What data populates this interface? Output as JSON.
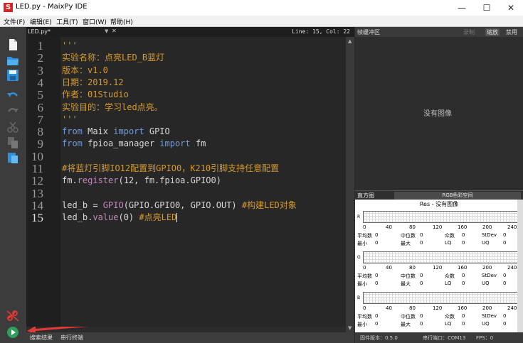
{
  "window": {
    "title": "LED.py - MaixPy IDE",
    "minimize": "—",
    "maximize": "☐",
    "close": "✕"
  },
  "menu": [
    "文件(F)",
    "编辑(E)",
    "工具(T)",
    "窗口(W)",
    "帮助(H)"
  ],
  "toolbar": {
    "tools": [
      "new-file-icon",
      "open-folder-icon",
      "save-icon",
      "undo-icon",
      "redo-icon",
      "cut-icon",
      "copy-icon",
      "paste-icon",
      "disconnect-icon",
      "run-icon"
    ]
  },
  "editor": {
    "file_tab": "LED.py*",
    "cursor": "Line: 15, Col: 22",
    "line_numbers": [
      "1",
      "2",
      "3",
      "4",
      "5",
      "6",
      "7",
      "8",
      "9",
      "10",
      "11",
      "12",
      "13",
      "14",
      "15"
    ],
    "lines": [
      [
        {
          "t": "'''",
          "c": "c-doc"
        }
      ],
      [
        {
          "t": "实验名称：点亮LED_B蓝灯",
          "c": "c-doc"
        }
      ],
      [
        {
          "t": "版本：v1.0",
          "c": "c-doc"
        }
      ],
      [
        {
          "t": "日期：2019.12",
          "c": "c-doc"
        }
      ],
      [
        {
          "t": "作者：01Studio",
          "c": "c-doc"
        }
      ],
      [
        {
          "t": "实验目的：学习led点亮。",
          "c": "c-doc"
        }
      ],
      [
        {
          "t": "'''",
          "c": "c-doc"
        }
      ],
      [
        {
          "t": "from",
          "c": "c-kw"
        },
        {
          "t": " Maix ",
          "c": "c-fn"
        },
        {
          "t": "import",
          "c": "c-kw"
        },
        {
          "t": " GPIO",
          "c": "c-fn"
        }
      ],
      [
        {
          "t": "from",
          "c": "c-kw"
        },
        {
          "t": " fpioa_manager ",
          "c": "c-fn"
        },
        {
          "t": "import",
          "c": "c-kw"
        },
        {
          "t": " fm",
          "c": "c-fn"
        }
      ],
      [],
      [
        {
          "t": "#将蓝灯引脚IO12配置到GPIO0，K210引脚支持任意配置",
          "c": "c-cm"
        }
      ],
      [
        {
          "t": "fm.",
          "c": "c-fn"
        },
        {
          "t": "register",
          "c": "c-call"
        },
        {
          "t": "(12, fm.fpioa.GPIO0)",
          "c": "c-fn"
        }
      ],
      [],
      [
        {
          "t": "led_b = ",
          "c": "c-fn"
        },
        {
          "t": "GPIO",
          "c": "c-call"
        },
        {
          "t": "(GPIO.GPIO0, GPIO.OUT) ",
          "c": "c-fn"
        },
        {
          "t": "#构建LED对象",
          "c": "c-cm"
        }
      ],
      [
        {
          "t": "led_b.",
          "c": "c-fn"
        },
        {
          "t": "value",
          "c": "c-call"
        },
        {
          "t": "(0) ",
          "c": "c-fn"
        },
        {
          "t": "#点亮LED",
          "c": "c-cm"
        }
      ]
    ]
  },
  "bottom_tabs": [
    "搜索结果",
    "串行终端"
  ],
  "frame_buffer": {
    "title": "帧缓冲区",
    "buttons": [
      "录制",
      "缩放",
      "禁用"
    ],
    "empty_text": "没有图像"
  },
  "histogram": {
    "title": "直方图",
    "color_space": "RGB色彩空间",
    "resolution": "Res - 没有图像",
    "ticks": [
      "0",
      "40",
      "80",
      "120",
      "160",
      "200",
      "240"
    ],
    "channels": [
      {
        "label": "R",
        "row1": [
          "平均数",
          "0",
          "中位数",
          "0",
          "众数",
          "0",
          "StDev",
          "0"
        ],
        "row2": [
          "最小",
          "0",
          "最大",
          "0",
          "LQ",
          "0",
          "UQ",
          "0"
        ]
      },
      {
        "label": "G",
        "row1": [
          "平均数",
          "0",
          "中位数",
          "0",
          "众数",
          "0",
          "StDev",
          "0"
        ],
        "row2": [
          "最小",
          "0",
          "最大",
          "0",
          "LQ",
          "0",
          "UQ",
          "0"
        ]
      },
      {
        "label": "B",
        "row1": [
          "平均数",
          "0",
          "中位数",
          "0",
          "众数",
          "0",
          "StDev",
          "0"
        ],
        "row2": [
          "最小",
          "0",
          "最大",
          "0",
          "LQ",
          "0",
          "UQ",
          "0"
        ]
      }
    ]
  },
  "status": {
    "firmware": "固件版本：0.5.0",
    "port": "串行端口：COM13",
    "fps": "FPS：0"
  },
  "colors": {
    "accent_red": "#e53935",
    "run_green": "#2e9e5b",
    "icon_blue": "#2f8fd8"
  }
}
